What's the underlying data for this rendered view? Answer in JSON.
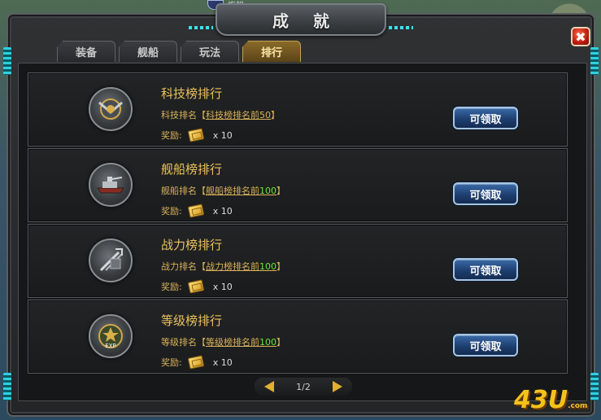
{
  "window": {
    "title": "成就",
    "top_label": "旗舰",
    "close_glyph": "✖"
  },
  "tabs": [
    {
      "label": "装备",
      "active": false
    },
    {
      "label": "舰船",
      "active": false
    },
    {
      "label": "玩法",
      "active": false
    },
    {
      "label": "排行",
      "active": true
    }
  ],
  "rows": [
    {
      "title": "科技榜排行",
      "rank_label": "科技排名",
      "link_text": "科技榜排名前",
      "link_num": "50",
      "reward_label": "奖励:",
      "reward_qty": "x 10",
      "button": "可领取",
      "icon": "tech-medal-icon"
    },
    {
      "title": "舰船榜排行",
      "rank_label": "舰船排名",
      "link_text": "舰船榜排名前",
      "link_num": "100",
      "reward_label": "奖励:",
      "reward_qty": "x 10",
      "button": "可领取",
      "icon": "warship-icon"
    },
    {
      "title": "战力榜排行",
      "rank_label": "战力排名",
      "link_text": "战力榜排名前",
      "link_num": "100",
      "reward_label": "奖励:",
      "reward_qty": "x 10",
      "button": "可领取",
      "icon": "crossed-tridents-icon"
    },
    {
      "title": "等级榜排行",
      "rank_label": "等级排名",
      "link_text": "等级榜排名前",
      "link_num": "100",
      "reward_label": "奖励:",
      "reward_qty": "x 10",
      "button": "可领取",
      "icon": "exp-medal-icon"
    }
  ],
  "pager": {
    "text": "1/2"
  },
  "watermark": {
    "main": "43U",
    "suffix": ".com"
  },
  "colors": {
    "accent_gold": "#ecc25a",
    "link_green": "#6fe03c",
    "button_blue": "#1e3f70",
    "close_red": "#c01a10"
  }
}
